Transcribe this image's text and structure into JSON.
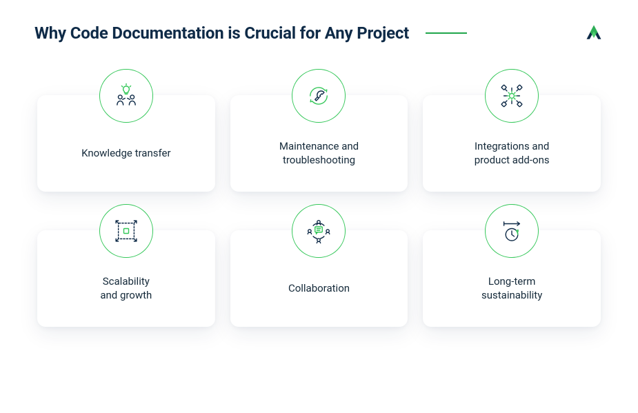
{
  "title": "Why Code Documentation is Crucial for Any Project",
  "colors": {
    "accent": "#34c759",
    "accentDark": "#1fa54a",
    "navy": "#0e2a47",
    "text": "#152a3a"
  },
  "cards": [
    {
      "label": "Knowledge transfer",
      "icon": "people-idea-icon"
    },
    {
      "label": "Maintenance and\ntroubleshooting",
      "icon": "wrench-cycle-icon"
    },
    {
      "label": "Integrations and\nproduct add-ons",
      "icon": "gears-network-icon"
    },
    {
      "label": "Scalability\nand growth",
      "icon": "expand-frame-icon"
    },
    {
      "label": "Collaboration",
      "icon": "chat-group-icon"
    },
    {
      "label": "Long-term\nsustainability",
      "icon": "clock-arrow-icon"
    }
  ]
}
